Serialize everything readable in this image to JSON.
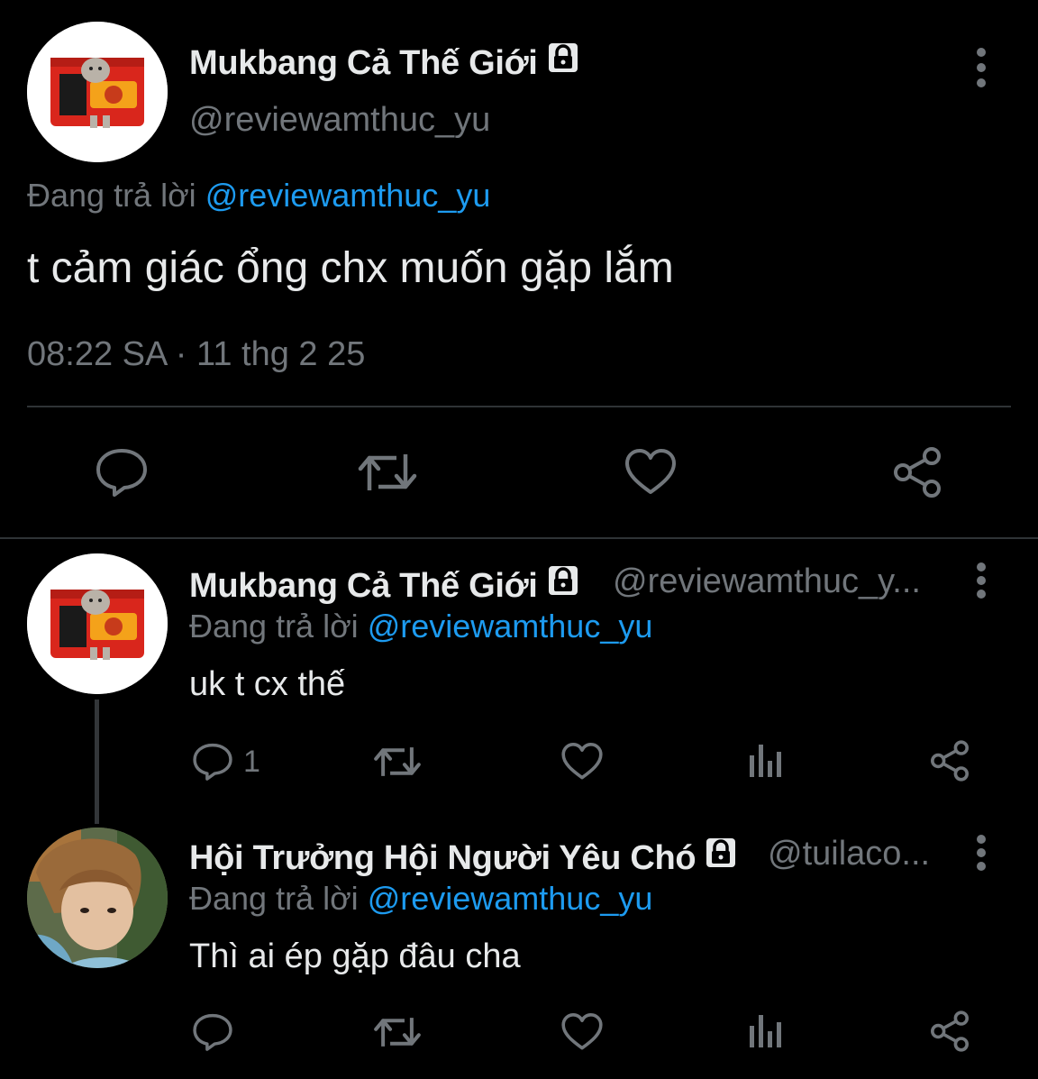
{
  "main_tweet": {
    "display_name": "Mukbang Cả Thế Giới",
    "handle": "@reviewamthuc_yu",
    "reply_prefix": "Đang trả lời ",
    "reply_mention": "@reviewamthuc_yu",
    "text": "t cảm giác ổng chx muốn gặp lắm",
    "timestamp": "08:22 SA · 11 thg 2 25",
    "actions": [
      "reply-icon",
      "retweet-icon",
      "like-icon",
      "share-icon"
    ]
  },
  "replies": [
    {
      "display_name": "Mukbang Cả Thế Giới",
      "handle": "@reviewamthuc_y...",
      "reply_prefix": "Đang trả lời ",
      "reply_mention": "@reviewamthuc_yu",
      "text": "uk t cx thế",
      "reply_count": "1"
    },
    {
      "display_name": "Hội Trưởng Hội Người Yêu Chó",
      "handle": "@tuilaco...",
      "reply_prefix": "Đang trả lời ",
      "reply_mention": "@reviewamthuc_yu",
      "text": "Thì ai ép gặp đâu cha",
      "reply_count": ""
    }
  ],
  "colors": {
    "background": "#000000",
    "text": "#e7e9ea",
    "secondary": "#71767b",
    "accent": "#1d9bf0",
    "divider": "#2f3336"
  }
}
